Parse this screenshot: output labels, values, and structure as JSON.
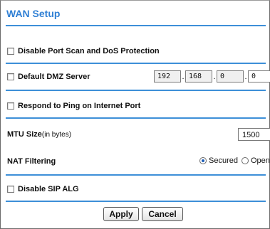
{
  "page": {
    "title": "WAN Setup"
  },
  "options": {
    "disable_port_scan_label": "Disable Port Scan and DoS Protection",
    "disable_port_scan_checked": false,
    "default_dmz_label": "Default DMZ Server",
    "default_dmz_checked": false,
    "dmz_ip": [
      "192",
      "168",
      "0",
      "0"
    ],
    "respond_ping_label": "Respond to Ping on Internet Port",
    "respond_ping_checked": false,
    "mtu_label": "MTU Size",
    "mtu_unit": "(in bytes)",
    "mtu_value": "1500",
    "nat_label": "NAT Filtering",
    "nat_options": [
      "Secured",
      "Open"
    ],
    "nat_selected": "Secured",
    "disable_sip_label": "Disable SIP ALG",
    "disable_sip_checked": false
  },
  "buttons": {
    "apply": "Apply",
    "cancel": "Cancel"
  },
  "colors": {
    "accent": "#2f7fd4",
    "divider": "#3d8fd8"
  }
}
